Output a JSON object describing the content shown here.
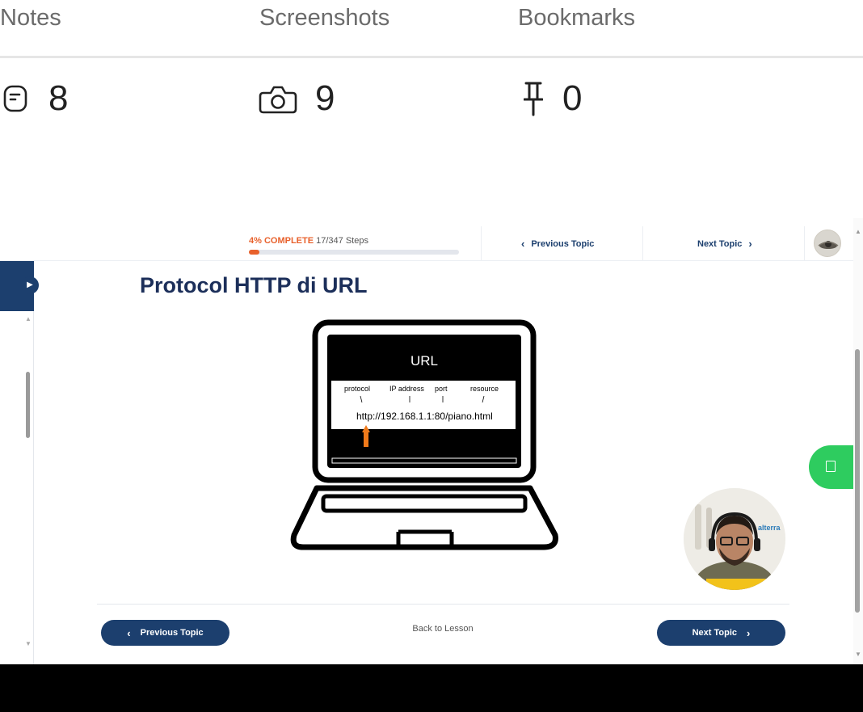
{
  "tabs": {
    "notes_label": "Notes",
    "screenshots_label": "Screenshots",
    "bookmarks_label": "Bookmarks"
  },
  "stats": {
    "notes_count": "8",
    "notes_icon": "note-icon",
    "screenshots_count": "9",
    "screenshots_icon": "camera-icon",
    "bookmarks_count": "0",
    "bookmarks_icon": "pin-icon"
  },
  "course": {
    "progress_percent_label": "4% COMPLETE",
    "progress_steps": "17/347 Steps",
    "progress_fraction": 0.049,
    "top_prev_label": "Previous Topic",
    "top_next_label": "Next Topic",
    "lesson_title": "Protocol HTTP di URL",
    "url_card": {
      "heading": "URL",
      "part_protocol": "protocol",
      "part_ip": "IP address",
      "part_port": "port",
      "part_resource": "resource",
      "example_url": "http://192.168.1.1:80/piano.html"
    },
    "facecam_brand": "alterra",
    "bottom_prev_label": "Previous Topic",
    "back_to_lesson_label": "Back to Lesson",
    "bottom_next_label": "Next Topic"
  },
  "colors": {
    "navy": "#1c3f6e",
    "accent_orange": "#e8612c",
    "chat_green": "#2ecc5f"
  }
}
